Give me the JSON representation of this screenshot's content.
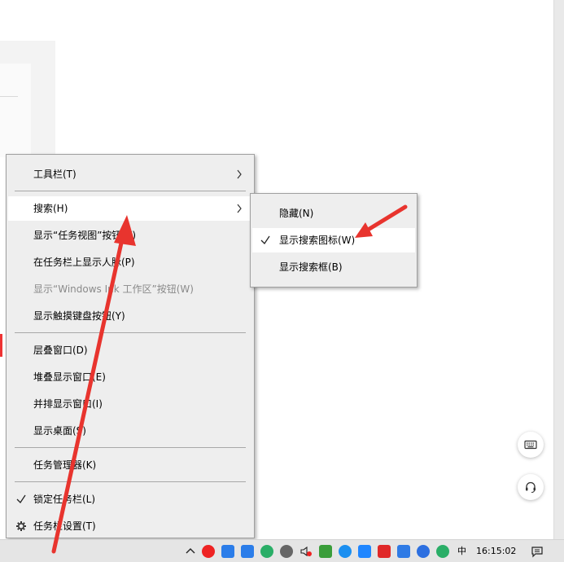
{
  "main_menu": {
    "items": [
      {
        "label": "工具栏(T)",
        "submenu": true
      },
      {
        "label": "搜索(H)",
        "submenu": true,
        "highlighted": true
      },
      {
        "label": "显示“任务视图”按钮(V)"
      },
      {
        "label": "在任务栏上显示人脉(P)"
      },
      {
        "label": "显示“Windows Ink 工作区”按钮(W)",
        "disabled": true
      },
      {
        "label": "显示触摸键盘按钮(Y)"
      },
      {
        "label": "层叠窗口(D)"
      },
      {
        "label": "堆叠显示窗口(E)"
      },
      {
        "label": "并排显示窗口(I)"
      },
      {
        "label": "显示桌面(S)"
      },
      {
        "label": "任务管理器(K)"
      },
      {
        "label": "锁定任务栏(L)",
        "checked": true
      },
      {
        "label": "任务栏设置(T)",
        "icon": "gear-icon"
      }
    ]
  },
  "search_submenu": {
    "items": [
      {
        "label": "隐藏(N)"
      },
      {
        "label": "显示搜索图标(W)",
        "checked": true,
        "highlighted": true
      },
      {
        "label": "显示搜索框(B)"
      }
    ]
  },
  "floating": {
    "keyboard_icon": "keyboard-icon",
    "support_icon": "headset-icon"
  },
  "taskbar": {
    "ime": "中",
    "clock": "16:15:02",
    "notification_icon": "action-center-icon"
  },
  "colors": {
    "menu_bg": "#eeeeee",
    "highlight": "#ffffff",
    "disabled_text": "#8a8a8a",
    "annotation_arrow": "#e8342e"
  }
}
